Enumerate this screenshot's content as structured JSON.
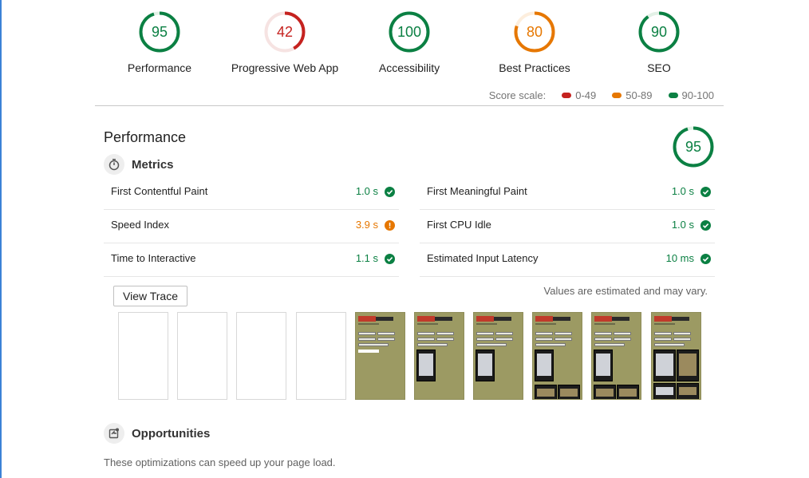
{
  "gauges": [
    {
      "score": "95",
      "label": "Performance",
      "pct": 0.95,
      "color": "#0b8043",
      "bg": "#e2f1e6"
    },
    {
      "score": "42",
      "label": "Progressive Web App",
      "pct": 0.42,
      "color": "#c5221f",
      "bg": "#f6e3e2"
    },
    {
      "score": "100",
      "label": "Accessibility",
      "pct": 1.0,
      "color": "#0b8043",
      "bg": "#e2f1e6"
    },
    {
      "score": "80",
      "label": "Best Practices",
      "pct": 0.8,
      "color": "#e67700",
      "bg": "#fdeedd"
    },
    {
      "score": "90",
      "label": "SEO",
      "pct": 0.9,
      "color": "#0b8043",
      "bg": "#e2f1e6"
    }
  ],
  "score_scale": {
    "label": "Score scale:",
    "ranges": [
      {
        "text": "0-49",
        "color": "#c5221f"
      },
      {
        "text": "50-89",
        "color": "#e67700"
      },
      {
        "text": "90-100",
        "color": "#0b8043"
      }
    ]
  },
  "performance": {
    "title": "Performance",
    "score": "95",
    "pct": 0.95,
    "metrics_heading": "Metrics",
    "metrics": [
      {
        "name": "First Contentful Paint",
        "value": "1.0 s",
        "status": "pass"
      },
      {
        "name": "First Meaningful Paint",
        "value": "1.0 s",
        "status": "pass"
      },
      {
        "name": "Speed Index",
        "value": "3.9 s",
        "status": "average"
      },
      {
        "name": "First CPU Idle",
        "value": "1.0 s",
        "status": "pass"
      },
      {
        "name": "Time to Interactive",
        "value": "1.1 s",
        "status": "pass"
      },
      {
        "name": "Estimated Input Latency",
        "value": "10 ms",
        "status": "pass"
      }
    ],
    "view_trace_label": "View Trace",
    "estimate_note": "Values are estimated and may vary.",
    "filmstrip_frames": 10,
    "opportunities_heading": "Opportunities",
    "opportunities_desc": "These optimizations can speed up your page load."
  }
}
